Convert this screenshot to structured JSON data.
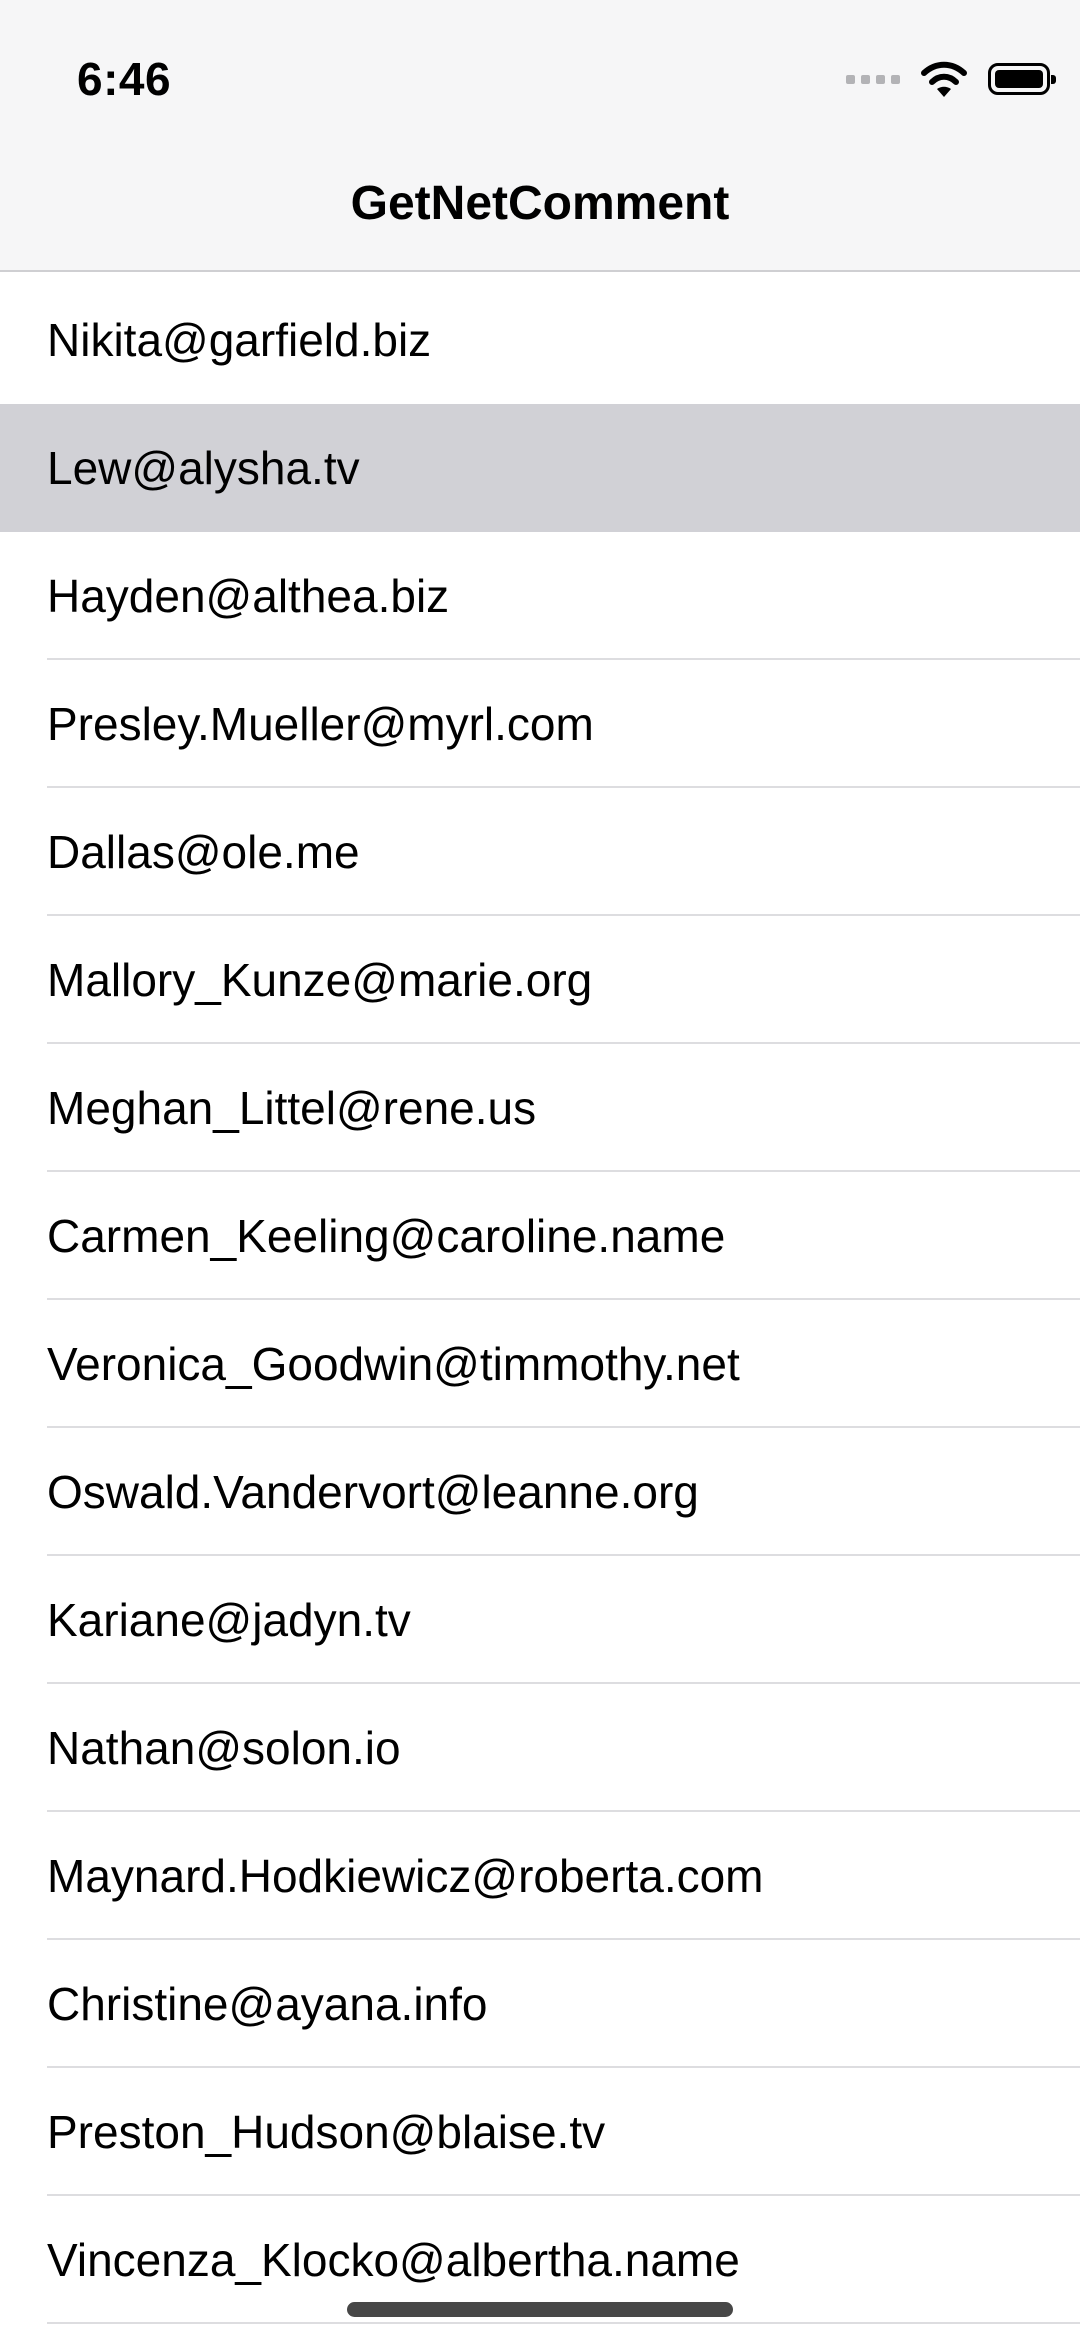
{
  "status_bar": {
    "time": "6:46",
    "icons": [
      "cellular-signal-icon",
      "wifi-icon",
      "battery-icon"
    ]
  },
  "nav": {
    "title": "GetNetComment"
  },
  "list": {
    "selected_index": 1,
    "items": [
      "Nikita@garfield.biz",
      "Lew@alysha.tv",
      "Hayden@althea.biz",
      "Presley.Mueller@myrl.com",
      "Dallas@ole.me",
      "Mallory_Kunze@marie.org",
      "Meghan_Littel@rene.us",
      "Carmen_Keeling@caroline.name",
      "Veronica_Goodwin@timmothy.net",
      "Oswald.Vandervort@leanne.org",
      "Kariane@jadyn.tv",
      "Nathan@solon.io",
      "Maynard.Hodkiewicz@roberta.com",
      "Christine@ayana.info",
      "Preston_Hudson@blaise.tv",
      "Vincenza_Klocko@albertha.name"
    ]
  },
  "colors": {
    "nav_background": "#f6f6f7",
    "selected_row": "#d1d1d6",
    "separator": "#dddde0"
  }
}
